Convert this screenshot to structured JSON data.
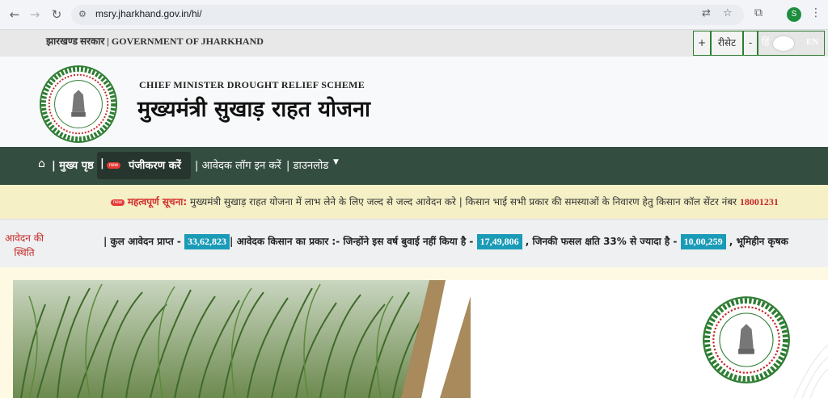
{
  "browser": {
    "url": "msry.jharkhand.gov.in/hi/",
    "profile_initial": "S"
  },
  "gov_strip": {
    "title": "झारखण्ड सरकार | GOVERNMENT OF JHARKHAND",
    "increase": "+",
    "reset": "रीसेट",
    "decrease": "-",
    "lang_hi": "हिं",
    "lang_en": "EN"
  },
  "header": {
    "scheme_en": "CHIEF MINISTER DROUGHT RELIEF SCHEME",
    "scheme_hi": "मुख्यमंत्री सुखाड़ राहत योजना"
  },
  "nav": {
    "home": "| मुख्य पृष्ठ",
    "register": "पंजीकरण करें",
    "register_badge": "new",
    "login": "| आवेदक लॉग इन करें",
    "download": "| डाउनलोड"
  },
  "notice": {
    "badge": "new",
    "label": "महत्वपूर्ण सूचना:",
    "text": " मुख्यमंत्री सुखाड़ राहत योजना में लाभ लेने के लिए जल्द से जल्द आवेदन करे | किसान भाई सभी प्रकार की समस्याओं के निवारण हेतु किसान कॉल सेंटर नंबर ",
    "number": "18001231"
  },
  "status": {
    "title": "आवेदन की स्थिति",
    "total_label": "| कुल आवेदन प्राप्त - ",
    "total_value": "33,62,823",
    "type_label": "| आवेदक किसान का प्रकार :- जिन्होंने इस वर्ष बुवाई नहीं किया है - ",
    "no_sowing_value": "17,49,806",
    "crop_loss_label": " , जिनकी फसल क्षति 33% से ज्यादा है - ",
    "crop_loss_value": "10,00,259",
    "landless_label": " , भूमिहीन कृषक"
  },
  "seal": {
    "top_text": "झारखण्ड सरकार",
    "bottom_text": "GOVERNMENT OF JHARKHAND"
  },
  "colors": {
    "nav_bg": "#344d41",
    "notice_bg": "#f5f0c6",
    "count_bg": "#1a9bb8",
    "accent_red": "#c62828"
  }
}
